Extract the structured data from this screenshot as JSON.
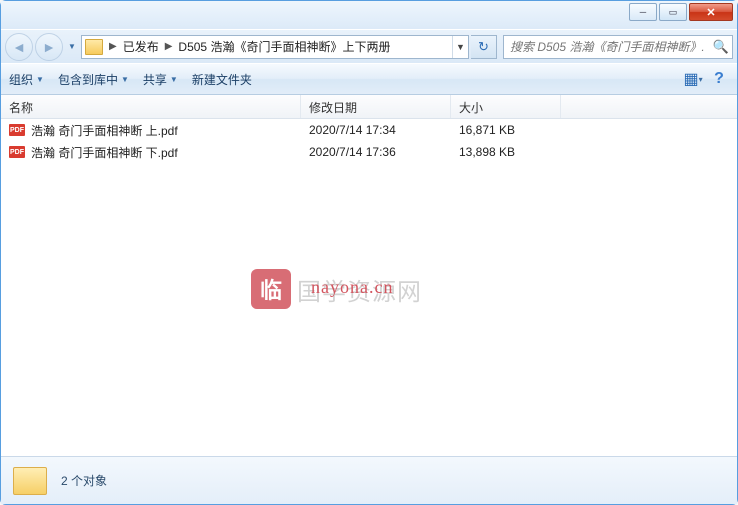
{
  "breadcrumb": {
    "item1": "已发布",
    "item2": "D505 浩瀚《奇门手面相神断》上下两册"
  },
  "search": {
    "placeholder": "搜索 D505 浩瀚《奇门手面相神断》..."
  },
  "toolbar": {
    "organize": "组织",
    "include": "包含到库中",
    "share": "共享",
    "newfolder": "新建文件夹"
  },
  "columns": {
    "name": "名称",
    "date": "修改日期",
    "size": "大小"
  },
  "files": [
    {
      "name": "浩瀚 奇门手面相神断 上.pdf",
      "date": "2020/7/14 17:34",
      "size": "16,871 KB"
    },
    {
      "name": "浩瀚 奇门手面相神断 下.pdf",
      "date": "2020/7/14 17:36",
      "size": "13,898 KB"
    }
  ],
  "watermark": {
    "cn": "国学资源网",
    "en": "nayona.cn"
  },
  "status": {
    "text": "2 个对象"
  }
}
